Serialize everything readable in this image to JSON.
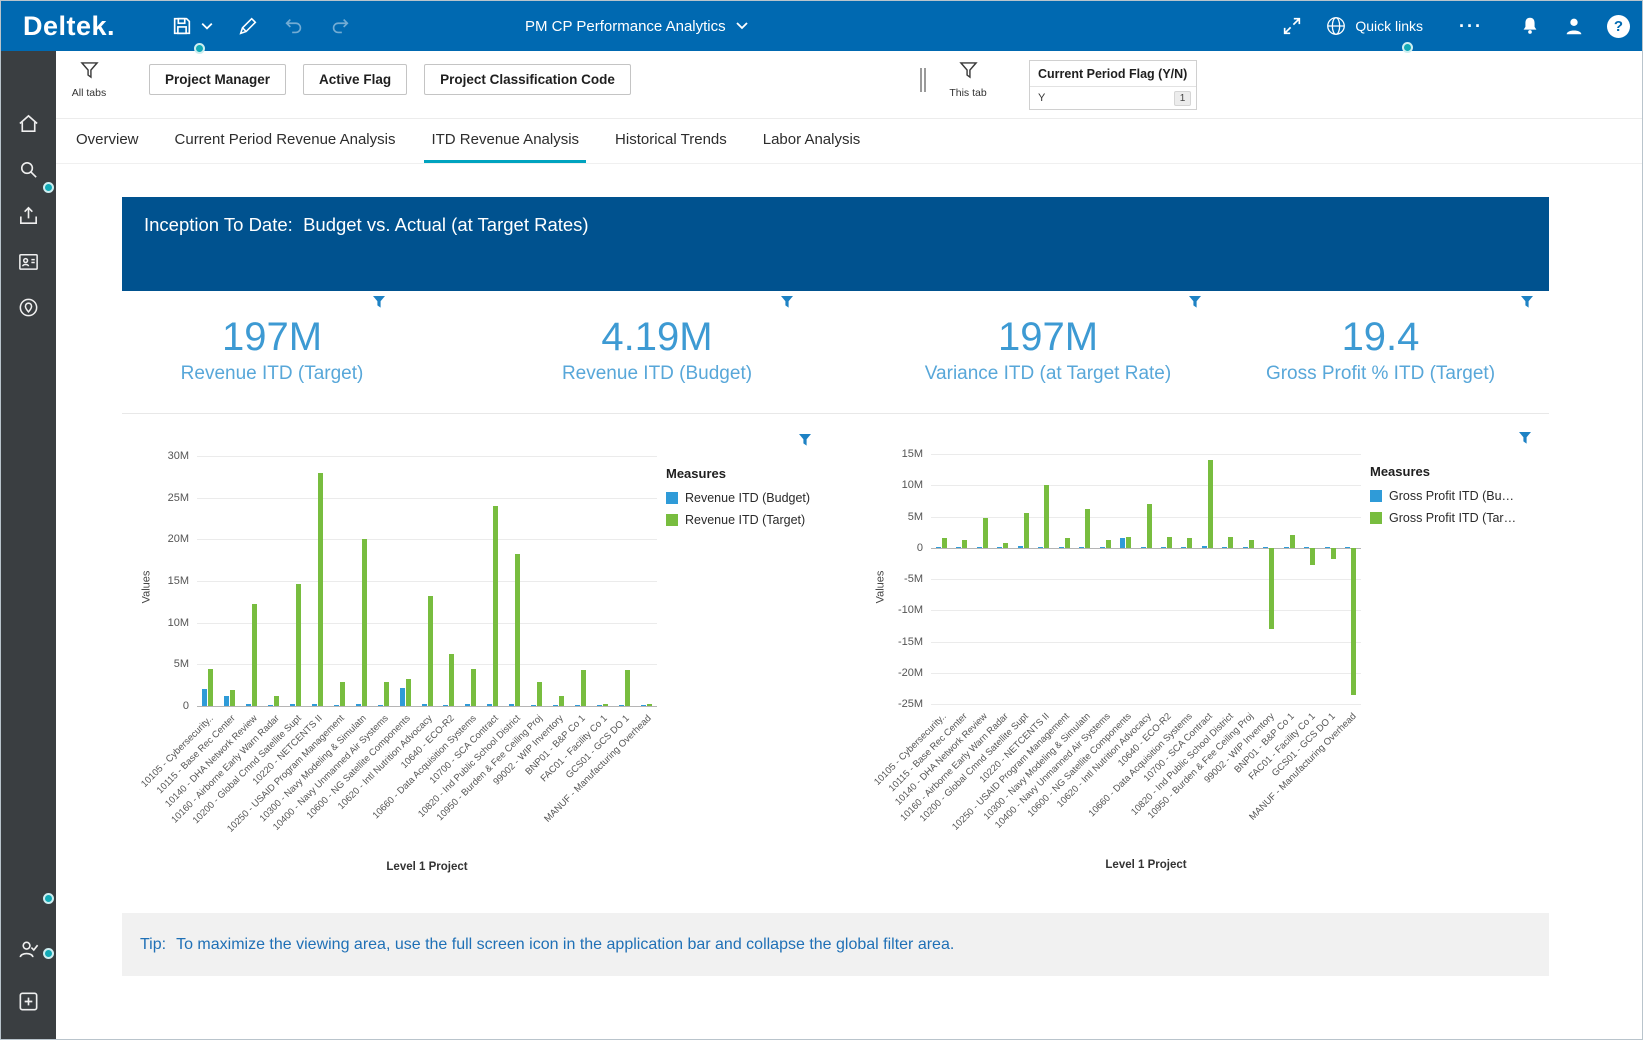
{
  "app": {
    "logo": "Deltek.",
    "title": "PM CP Performance Analytics",
    "quick_links_label": "Quick links",
    "more_label": "···",
    "help_label": "?"
  },
  "icons": {
    "topbar": [
      "save-icon",
      "save-chevron-icon",
      "edit-icon",
      "undo-icon",
      "redo-icon",
      "title-chevron-icon",
      "fullscreen-icon",
      "globe-icon",
      "more-icon",
      "bell-icon",
      "user-icon",
      "help-icon"
    ],
    "sidebar": [
      "home-icon",
      "search-icon",
      "export-icon",
      "contacts-icon",
      "location-icon",
      "user-check-icon",
      "add-icon"
    ],
    "filter": [
      "filter-funnel-icon"
    ]
  },
  "filters": {
    "all_tabs_label": "All tabs",
    "this_tab_label": "This tab",
    "buttons": [
      {
        "label": "Project Manager"
      },
      {
        "label": "Active Flag"
      },
      {
        "label": "Project Classification Code"
      }
    ],
    "current_period": {
      "label": "Current Period Flag (Y/N)",
      "value": "Y",
      "count": "1"
    }
  },
  "tabs": [
    {
      "label": "Overview",
      "active": false
    },
    {
      "label": "Current Period Revenue Analysis",
      "active": false
    },
    {
      "label": "ITD Revenue Analysis",
      "active": true
    },
    {
      "label": "Historical Trends",
      "active": false
    },
    {
      "label": "Labor Analysis",
      "active": false
    }
  ],
  "banner": {
    "title": "Inception To Date:  Budget vs. Actual (at Target Rates)"
  },
  "kpis": [
    {
      "value": "197M",
      "label": "Revenue ITD (Target)"
    },
    {
      "value": "4.19M",
      "label": "Revenue ITD (Budget)"
    },
    {
      "value": "197M",
      "label": "Variance ITD (at Target Rate)"
    },
    {
      "value": "19.4",
      "label": "Gross Profit % ITD (Target)"
    }
  ],
  "tip": {
    "prefix": "Tip:",
    "text": "To maximize the viewing area, use the full screen icon in the application bar and collapse the global filter area."
  },
  "colors": {
    "topbar": "#0069b1",
    "banner": "#00528f",
    "active_tab": "#00a3bf",
    "kpi_value": "#3d9ad3",
    "kpi_label": "#58a7d9",
    "budget_bar": "#2f9bd8",
    "target_bar": "#78bd3f",
    "tip_text": "#1f70b6"
  },
  "chart_data": [
    {
      "type": "bar",
      "title": "",
      "xlabel": "Level 1 Project",
      "ylabel": "Values",
      "values_unit": "millions",
      "ylim": [
        0,
        30
      ],
      "ytick_step": 5,
      "tick_suffix": "M",
      "grid": true,
      "legend_position": "right",
      "legend_title": "Measures",
      "categories": [
        "10105 - Cybersecurity..",
        "10115 - Base Rec Center",
        "10140 - DHA Network Review",
        "10160 - Airborne Early Warn Radar",
        "10200 - Global Cmnd Satellite Supt",
        "10220 - NETCENTS II",
        "10250 - USAID Program Management",
        "10300 - Navy Modeling & Simulatn",
        "10400 - Navy Unmanned Air Systems",
        "10600 - NG Satellite Components",
        "10620 - Intl Nutrition Advocacy",
        "10640 - ECO-R2",
        "10660 - Data Acquisition Systems",
        "10700 - SCA Contract",
        "10820 - Ind Public School District",
        "10950 - Burden & Fee Ceiling Proj",
        "99002 - WIP Inventory",
        "BNP01 - B&P Co 1",
        "FAC01 - Facility Co 1",
        "GCS01 - GCS DO 1",
        "MANUF - Manufacturing Overhead"
      ],
      "series": [
        {
          "name": "Revenue ITD (Budget)",
          "color": "#2f9bd8",
          "values": [
            2.0,
            1.2,
            0.2,
            0.1,
            0.3,
            0.2,
            0.1,
            0.2,
            0.1,
            2.2,
            0.2,
            0.1,
            0.2,
            0.3,
            0.2,
            0.1,
            0.1,
            0.1,
            0.1,
            0.1,
            0.1
          ]
        },
        {
          "name": "Revenue ITD (Target)",
          "color": "#78bd3f",
          "values": [
            4.5,
            1.9,
            12.2,
            1.2,
            14.7,
            28.0,
            2.9,
            20.0,
            2.9,
            3.3,
            13.2,
            6.3,
            4.5,
            24.0,
            18.3,
            2.9,
            1.2,
            4.3,
            0.2,
            4.3,
            0.2
          ]
        }
      ]
    },
    {
      "type": "bar",
      "title": "",
      "xlabel": "Level 1 Project",
      "ylabel": "Values",
      "values_unit": "millions",
      "ylim": [
        -25,
        15
      ],
      "ytick_step": 5,
      "tick_suffix": "M",
      "grid": true,
      "legend_position": "right",
      "legend_title": "Measures",
      "categories": [
        "10105 - Cybersecurity..",
        "10115 - Base Rec Center",
        "10140 - DHA Network Review",
        "10160 - Airborne Early Warn Radar",
        "10200 - Global Cmnd Satellite Supt",
        "10220 - NETCENTS II",
        "10250 - USAID Program Management",
        "10300 - Navy Modeling & Simulatn",
        "10400 - Navy Unmanned Air Systems",
        "10600 - NG Satellite Components",
        "10620 - Intl Nutrition Advocacy",
        "10640 - ECO-R2",
        "10660 - Data Acquisition Systems",
        "10700 - SCA Contract",
        "10820 - Ind Public School District",
        "10950 - Burden & Fee Ceiling Proj",
        "99002 - WIP Inventory",
        "BNP01 - B&P Co 1",
        "FAC01 - Facility Co 1",
        "GCS01 - GCS DO 1",
        "MANUF - Manufacturing Overhead"
      ],
      "series": [
        {
          "name": "Gross Profit ITD (Bu…",
          "color": "#2f9bd8",
          "values": [
            0.2,
            0.1,
            0.2,
            0.1,
            0.3,
            0.2,
            0.1,
            0.2,
            0.1,
            1.5,
            0.2,
            0.1,
            0.2,
            0.3,
            0.2,
            0.1,
            0.1,
            0.1,
            0.1,
            0.1,
            0.1
          ]
        },
        {
          "name": "Gross Profit ITD (Tar…",
          "color": "#78bd3f",
          "values": [
            1.5,
            1.2,
            4.8,
            0.8,
            5.5,
            10.0,
            1.5,
            6.2,
            1.2,
            1.8,
            7.0,
            1.8,
            1.5,
            14.0,
            1.8,
            1.2,
            -13.0,
            2.0,
            -2.8,
            -1.8,
            -23.5
          ]
        }
      ]
    }
  ]
}
